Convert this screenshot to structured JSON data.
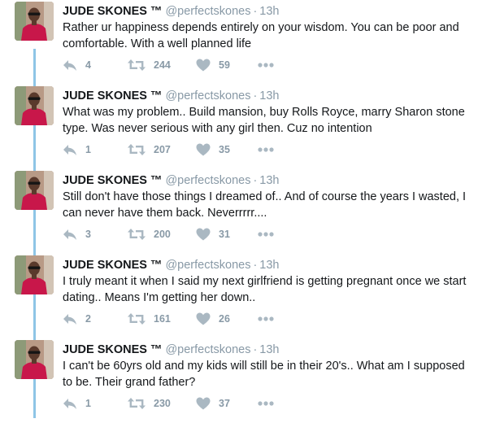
{
  "tweets": [
    {
      "name": "JUDE SKONES",
      "tm": "™",
      "handle": "@perfectskones",
      "time": "13h",
      "text": "Rather ur happiness depends entirely on your wisdom.   You can be poor and comfortable.  With a well planned life",
      "replies": "4",
      "retweets": "244",
      "likes": "59"
    },
    {
      "name": "JUDE SKONES",
      "tm": "™",
      "handle": "@perfectskones",
      "time": "13h",
      "text": "What was my problem..  Build mansion,  buy Rolls Royce,  marry Sharon stone type. Was never serious with any girl then.  Cuz no intention",
      "replies": "1",
      "retweets": "207",
      "likes": "35"
    },
    {
      "name": "JUDE SKONES",
      "tm": "™",
      "handle": "@perfectskones",
      "time": "13h",
      "text": "Still don't have those things I dreamed of.. And of course the years I wasted, I can never have them back.  Neverrrrr....",
      "replies": "3",
      "retweets": "200",
      "likes": "31"
    },
    {
      "name": "JUDE SKONES",
      "tm": "™",
      "handle": "@perfectskones",
      "time": "13h",
      "text": "I truly meant it when I said my next girlfriend is getting pregnant once we start dating..  Means I'm getting her down..",
      "replies": "2",
      "retweets": "161",
      "likes": "26"
    },
    {
      "name": "JUDE SKONES",
      "tm": "™",
      "handle": "@perfectskones",
      "time": "13h",
      "text": "I can't be 60yrs old and my kids will still be in their 20's..  What am I supposed to be.  Their grand father?",
      "replies": "1",
      "retweets": "230",
      "likes": "37"
    }
  ],
  "colors": {
    "thread_line": "#8ec5e6",
    "action_gray": "#aab8c2",
    "meta_gray": "#8899a6",
    "avatar_shirt": "#c8174a"
  },
  "icons": {
    "reply": "reply-icon",
    "retweet": "retweet-icon",
    "like": "heart-icon",
    "more": "more-icon"
  }
}
